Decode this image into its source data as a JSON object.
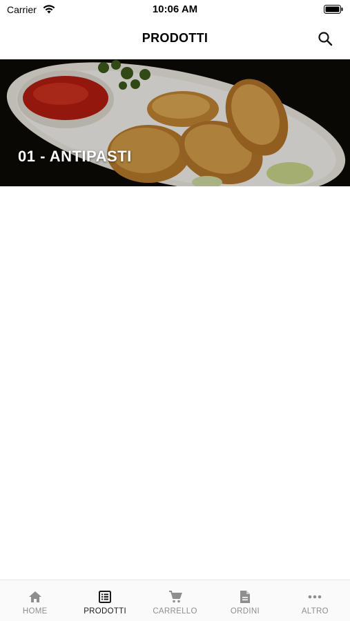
{
  "status_bar": {
    "carrier": "Carrier",
    "time": "10:06 AM"
  },
  "header": {
    "title": "PRODOTTI",
    "search_icon": "search-icon"
  },
  "categories": [
    {
      "label": "01 - ANTIPASTI",
      "image": "fried-appetizer-photo"
    }
  ],
  "tabbar": {
    "active_index": 1,
    "items": [
      {
        "label": "HOME",
        "icon": "home-icon"
      },
      {
        "label": "PRODOTTI",
        "icon": "list-icon"
      },
      {
        "label": "CARRELLO",
        "icon": "cart-icon"
      },
      {
        "label": "ORDINI",
        "icon": "document-icon"
      },
      {
        "label": "ALTRO",
        "icon": "more-icon"
      }
    ]
  },
  "colors": {
    "active": "#1a1a1a",
    "inactive": "#8e8e8e",
    "background": "#ffffff"
  }
}
